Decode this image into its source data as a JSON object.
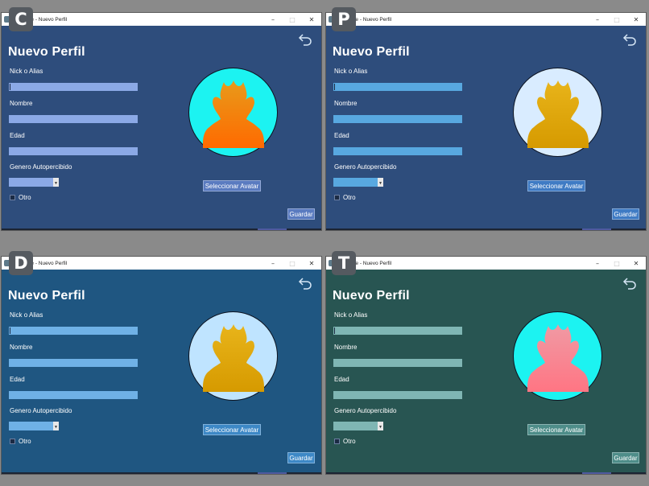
{
  "window_title": "Fromage - Nuevo Perfil",
  "window_controls": {
    "minimize": "–",
    "maximize": "□",
    "close": "✕"
  },
  "form": {
    "heading": "Nuevo Perfil",
    "nick_label": "Nick o Alias",
    "name_label": "Nombre",
    "age_label": "Edad",
    "gender_label": "Genero Autopercibido",
    "other_label": "Otro",
    "select_avatar_label": "Seleccionar Avatar",
    "save_label": "Guardar",
    "back_icon": "undo-arrow-icon",
    "avatar_icon": "flame-person-avatar-icon"
  },
  "variants": [
    {
      "badge": "C",
      "colors": {
        "bg": "#2e4d7c",
        "field": "#8ba9e6",
        "button": "#5a7bc0",
        "circle": "#1cf3f1",
        "avatar_top": "#e89a1a",
        "avatar_bottom": "#ff6a00"
      }
    },
    {
      "badge": "P",
      "colors": {
        "bg": "#2e4d7c",
        "field": "#58a8e0",
        "button": "#3f7bc4",
        "circle": "#d9ecff",
        "avatar_top": "#e8b41a",
        "avatar_bottom": "#d69a00"
      }
    },
    {
      "badge": "D",
      "colors": {
        "bg": "#1f5681",
        "field": "#6fb1e6",
        "button": "#3d88c6",
        "circle": "#bfe4ff",
        "avatar_top": "#e8b41a",
        "avatar_bottom": "#d69a00"
      }
    },
    {
      "badge": "T",
      "colors": {
        "bg": "#285552",
        "field": "#7fb6b4",
        "button": "#4e8d89",
        "circle": "#1cf3f1",
        "avatar_top": "#f09aa4",
        "avatar_bottom": "#ff7583"
      }
    }
  ]
}
